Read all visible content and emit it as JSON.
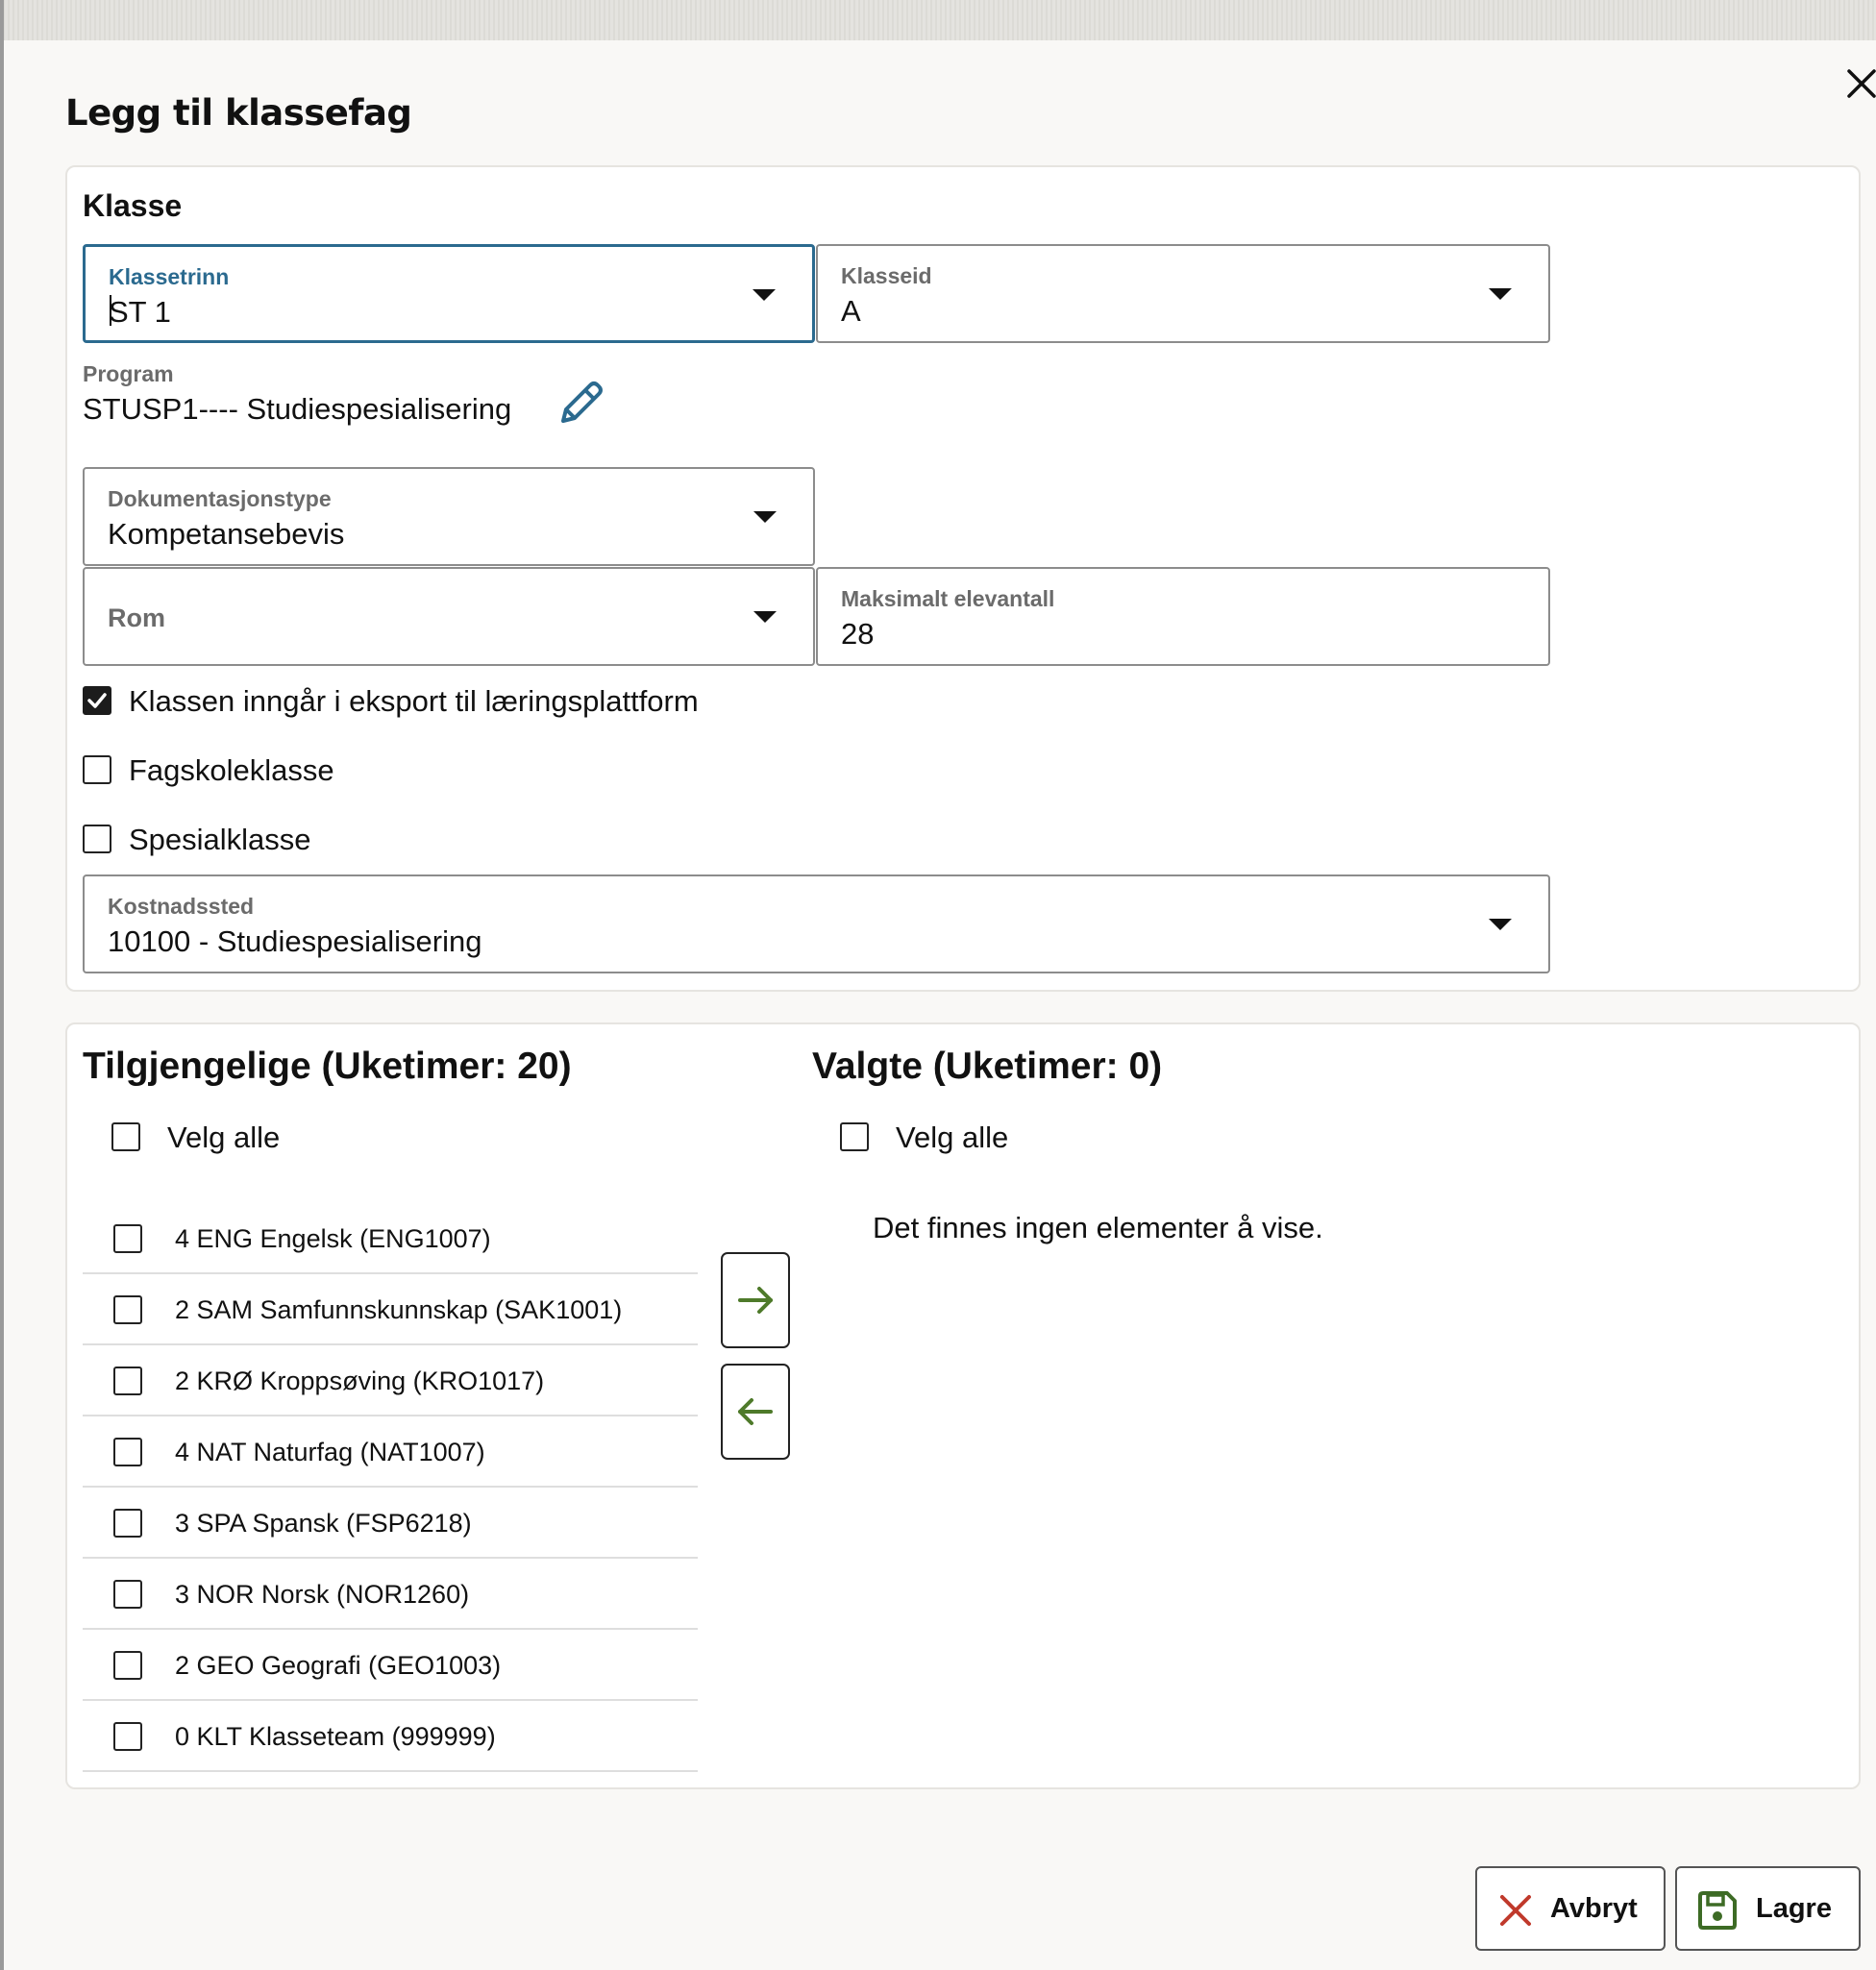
{
  "dialog": {
    "title": "Legg til klassefag",
    "close_icon": "close-icon"
  },
  "klasse": {
    "section_title": "Klasse",
    "klassetrinn": {
      "label": "Klassetrinn",
      "value": "ST 1"
    },
    "klasseid": {
      "label": "Klasseid",
      "value": "A"
    },
    "program": {
      "label": "Program",
      "value": "STUSP1---- Studiespesialisering",
      "edit_icon": "pencil-icon"
    },
    "dokumentasjonstype": {
      "label": "Dokumentasjonstype",
      "value": "Kompetansebevis"
    },
    "rom": {
      "placeholder": "Rom"
    },
    "maksimalt_elevantall": {
      "label": "Maksimalt elevantall",
      "value": "28"
    },
    "checkboxes": [
      {
        "label": "Klassen inngår i eksport til læringsplattform",
        "checked": true
      },
      {
        "label": "Fagskoleklasse",
        "checked": false
      },
      {
        "label": "Spesialklasse",
        "checked": false
      }
    ],
    "kostnadssted": {
      "label": "Kostnadssted",
      "value": "10100 - Studiespesialisering"
    }
  },
  "fag": {
    "available": {
      "heading": "Tilgjengelige (Uketimer: 20)",
      "select_all": "Velg alle",
      "items": [
        "4 ENG Engelsk (ENG1007)",
        "2 SAM Samfunnskunnskap (SAK1001)",
        "2 KRØ Kroppsøving (KRO1017)",
        "4 NAT Naturfag (NAT1007)",
        "3 SPA Spansk (FSP6218)",
        "3 NOR Norsk (NOR1260)",
        "2 GEO Geografi (GEO1003)",
        "0 KLT Klasseteam (999999)"
      ]
    },
    "selected": {
      "heading": "Valgte (Uketimer: 0)",
      "select_all": "Velg alle",
      "empty_text": "Det finnes ingen elementer å vise."
    },
    "move_right_icon": "arrow-right-icon",
    "move_left_icon": "arrow-left-icon"
  },
  "footer": {
    "cancel_label": "Avbryt",
    "save_label": "Lagre"
  },
  "colors": {
    "focus": "#2b6a8f",
    "arrow": "#4e7a2a",
    "cancel_icon": "#c0392b",
    "save_icon": "#3d6b25"
  }
}
